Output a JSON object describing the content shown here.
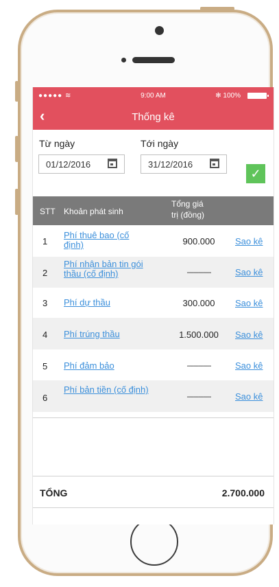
{
  "status_bar": {
    "signal": "●●●●● ≋",
    "time": "9:00 AM",
    "battery": "✻ 100%"
  },
  "nav": {
    "back_icon": "‹",
    "title": "Thống kê"
  },
  "filters": {
    "from_label": "Từ ngày",
    "from_value": "01/12/2016",
    "to_label": "Tới ngày",
    "to_value": "31/12/2016",
    "confirm_icon": "✓"
  },
  "table": {
    "headers": {
      "stt": "STT",
      "item": "Khoản phát sinh",
      "value_line1": "Tổng giá",
      "value_line2": "trị (đồng)"
    },
    "rows": [
      {
        "stt": "1",
        "name": "Phí thuê bao (cố định)",
        "value": "900.000",
        "link": "Sao kê"
      },
      {
        "stt": "2",
        "name": "Phí nhận bản tin gói thầu (cố định)",
        "value": "---------------",
        "link": "Sao kê"
      },
      {
        "stt": "3",
        "name": "Phí dự thầu",
        "value": "300.000",
        "link": "Sao kê"
      },
      {
        "stt": "4",
        "name": "Phí trúng thầu",
        "value": "1.500.000",
        "link": "Sao kê"
      },
      {
        "stt": "5",
        "name": "Phí đảm bảo",
        "value": "---------------",
        "link": "Sao kê"
      },
      {
        "stt": "6",
        "name": "Phí bản tiền (cố định)",
        "value": "---------------",
        "link": "Sao kê"
      }
    ]
  },
  "total": {
    "label": "TỔNG",
    "value": "2.700.000"
  },
  "colors": {
    "header_red": "#e2505e",
    "table_head_gray": "#7a7a7a",
    "link_blue": "#3b8fdb",
    "confirm_green": "#5fc45a",
    "frame_gold": "#c9ac84"
  }
}
